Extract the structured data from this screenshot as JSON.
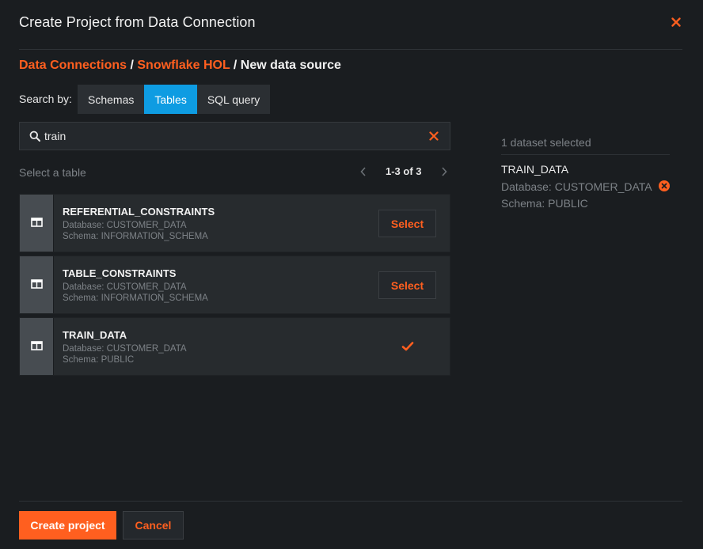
{
  "dialog": {
    "title": "Create Project from Data Connection"
  },
  "breadcrumb": {
    "items": [
      "Data Connections",
      "Snowflake HOL"
    ],
    "separator": "/",
    "current": "New data source"
  },
  "search_by": {
    "label": "Search by:",
    "tabs": [
      {
        "label": "Schemas",
        "active": false
      },
      {
        "label": "Tables",
        "active": true
      },
      {
        "label": "SQL query",
        "active": false
      }
    ]
  },
  "search": {
    "value": "train",
    "placeholder": ""
  },
  "list": {
    "label": "Select a table",
    "pagination": "1-3 of 3",
    "rows": [
      {
        "name": "REFERENTIAL_CONSTRAINTS",
        "database": "Database: CUSTOMER_DATA",
        "schema": "Schema: INFORMATION_SCHEMA",
        "action": "Select",
        "selected": false
      },
      {
        "name": "TABLE_CONSTRAINTS",
        "database": "Database: CUSTOMER_DATA",
        "schema": "Schema: INFORMATION_SCHEMA",
        "action": "Select",
        "selected": false
      },
      {
        "name": "TRAIN_DATA",
        "database": "Database: CUSTOMER_DATA",
        "schema": "Schema: PUBLIC",
        "action": "",
        "selected": true
      }
    ]
  },
  "selection": {
    "count_text": "1 dataset selected",
    "items": [
      {
        "name": "TRAIN_DATA",
        "database": "Database: CUSTOMER_DATA",
        "schema": "Schema: PUBLIC"
      }
    ]
  },
  "footer": {
    "create_label": "Create project",
    "cancel_label": "Cancel"
  },
  "icons": {
    "close": "close-icon",
    "search": "search-icon",
    "clear": "clear-icon",
    "table": "table-icon",
    "check": "check-icon",
    "remove": "remove-circle-icon",
    "prev": "chevron-left-icon",
    "next": "chevron-right-icon"
  },
  "colors": {
    "accent": "#ff5f1f",
    "active_tab": "#0e9ce2",
    "background": "#1a1d20"
  }
}
